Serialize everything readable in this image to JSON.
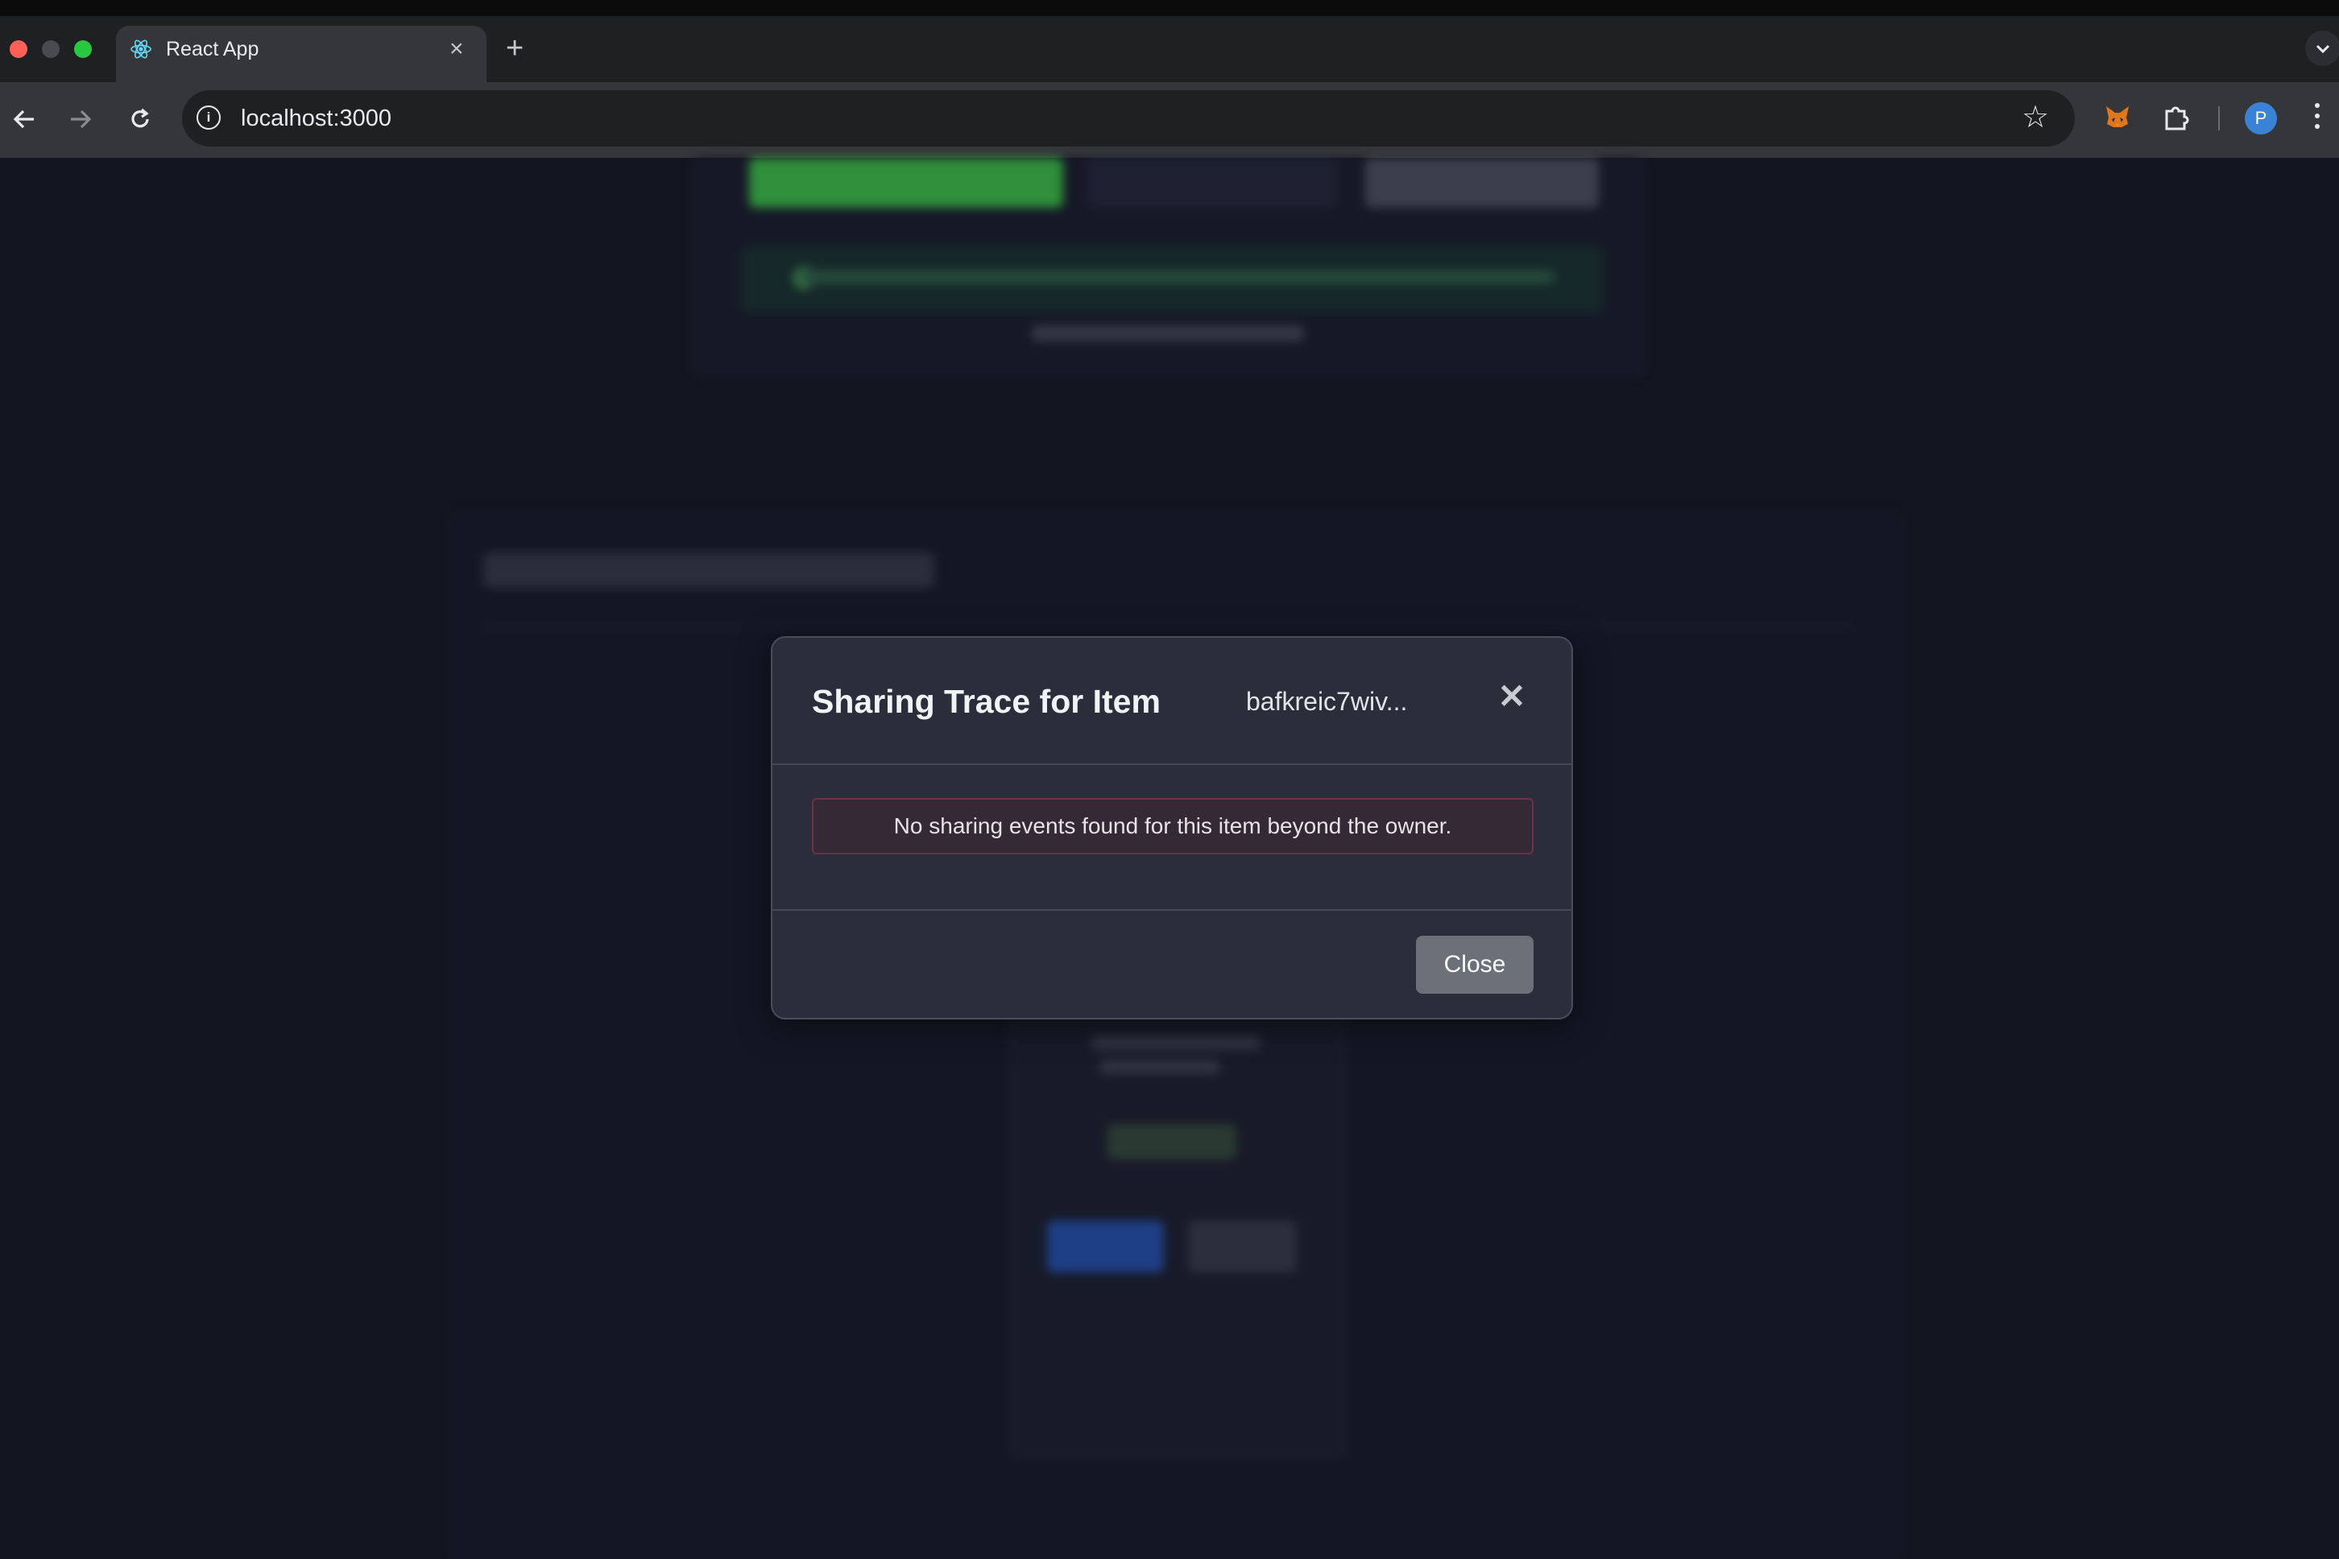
{
  "browser": {
    "tab_title": "React App",
    "tab_close_icon": "×",
    "new_tab_icon": "+",
    "url": "localhost:3000",
    "info_icon": "i",
    "star_icon": "☆",
    "profile_initial": "P"
  },
  "modal": {
    "title": "Sharing Trace for Item",
    "item_cid": "bafkreic7wiv...",
    "close_icon": "✕",
    "message": "No sharing events found for this item beyond the owner.",
    "close_label": "Close"
  },
  "colors": {
    "page_background": "#131520",
    "modal_background": "#2b2e3a",
    "alert_border": "#6b3344",
    "close_button": "#6c7078"
  }
}
